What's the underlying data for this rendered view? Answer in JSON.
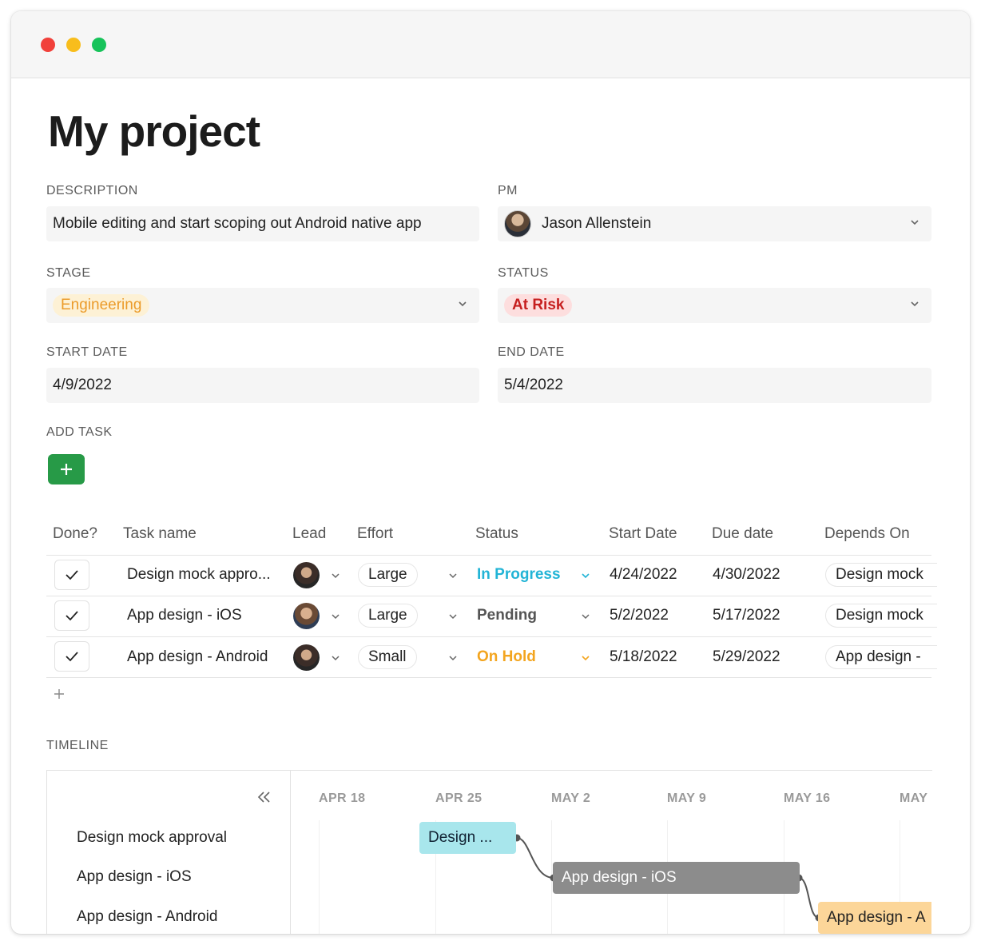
{
  "project": {
    "title": "My project",
    "description_label": "DESCRIPTION",
    "description_value": "Mobile editing and start scoping out Android native app",
    "pm_label": "PM",
    "pm_value": "Jason Allenstein",
    "stage_label": "STAGE",
    "stage_value": "Engineering",
    "status_label": "STATUS",
    "status_value": "At Risk",
    "start_date_label": "START DATE",
    "start_date_value": "4/9/2022",
    "end_date_label": "END DATE",
    "end_date_value": "5/4/2022",
    "add_task_label": "ADD TASK"
  },
  "table": {
    "headers": [
      "Done?",
      "Task name",
      "Lead",
      "Effort",
      "Status",
      "Start Date",
      "Due date",
      "Depends On"
    ],
    "rows": [
      {
        "name": "Design mock appro...",
        "effort": "Large",
        "status": "In Progress",
        "start": "4/24/2022",
        "due": "4/30/2022",
        "depends": "Design mock"
      },
      {
        "name": "App design - iOS",
        "effort": "Large",
        "status": "Pending",
        "start": "5/2/2022",
        "due": "5/17/2022",
        "depends": "Design mock"
      },
      {
        "name": "App design - Android",
        "effort": "Small",
        "status": "On Hold",
        "start": "5/18/2022",
        "due": "5/29/2022",
        "depends": "App design -"
      }
    ]
  },
  "colors": {
    "in_progress": "#22b4d6",
    "pending": "#555555",
    "on_hold": "#f3a51f",
    "add_button": "#279a47"
  },
  "timeline": {
    "label": "TIMELINE",
    "tasks": [
      "Design mock approval",
      "App design - iOS",
      "App design - Android"
    ],
    "weeks": [
      "APR 18",
      "APR 25",
      "MAY 2",
      "MAY 9",
      "MAY 16",
      "MAY"
    ],
    "bars": [
      "Design ...",
      "App design - iOS",
      "App design - A"
    ]
  }
}
